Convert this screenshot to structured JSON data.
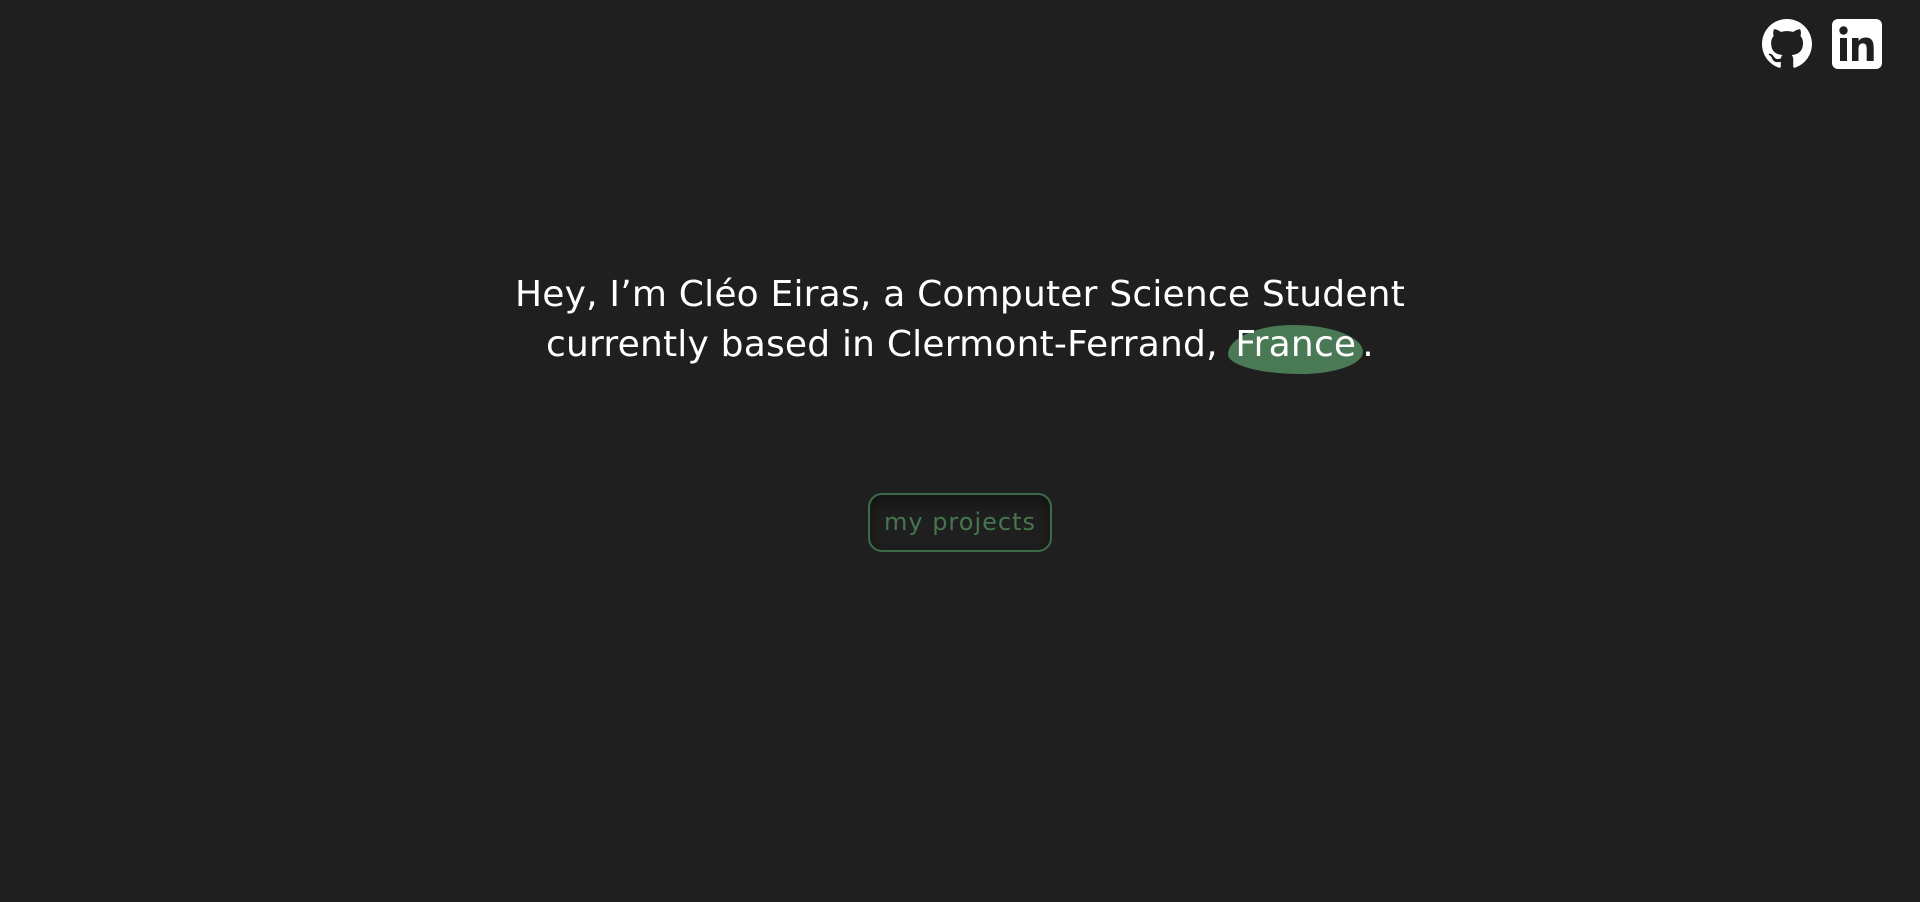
{
  "social": {
    "github_icon": "github-icon",
    "linkedin_icon": "linkedin-icon"
  },
  "hero": {
    "line1_prefix": "Hey, I’m ",
    "name": "Cléo Eiras",
    "line1_suffix": ", a Computer Science Student",
    "line2_prefix": "currently based in Clermont-Ferrand, ",
    "country": "France",
    "line2_suffix": "."
  },
  "cta": {
    "label": "my projects"
  },
  "colors": {
    "background": "#1f1f1f",
    "accent": "#497a55",
    "text": "#ffffff"
  }
}
